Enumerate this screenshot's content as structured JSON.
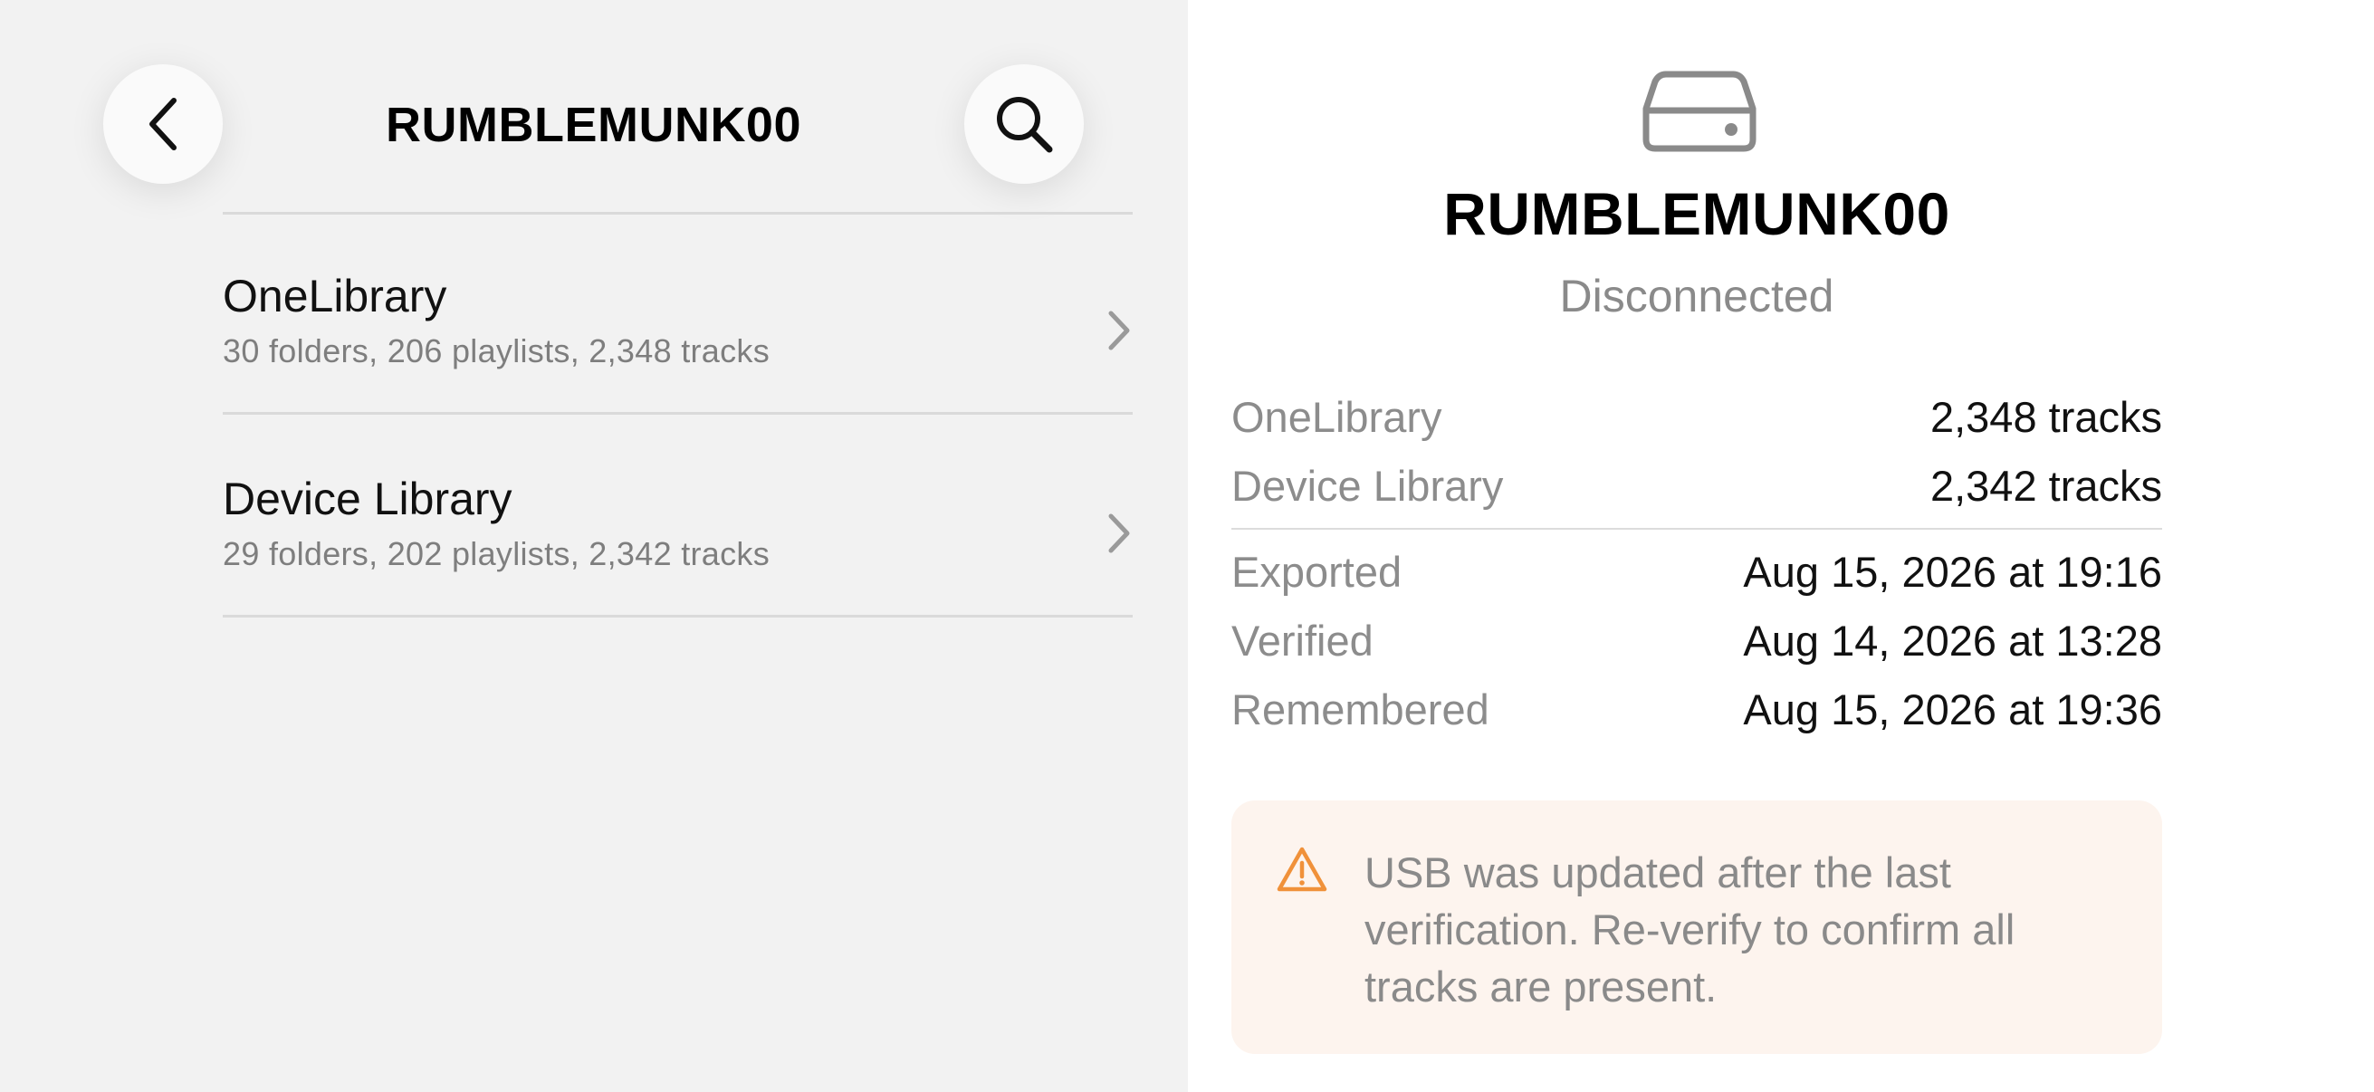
{
  "nav": {
    "title": "RUMBLEMUNK00",
    "back_icon": "chevron-left-icon",
    "search_icon": "search-icon"
  },
  "libraries": [
    {
      "title": "OneLibrary",
      "subtitle": "30 folders, 206 playlists, 2,348 tracks"
    },
    {
      "title": "Device Library",
      "subtitle": "29 folders, 202 playlists, 2,342 tracks"
    }
  ],
  "device": {
    "icon": "drive-icon",
    "name": "RUMBLEMUNK00",
    "status": "Disconnected"
  },
  "counts": [
    {
      "label": "OneLibrary",
      "value": "2,348 tracks"
    },
    {
      "label": "Device Library",
      "value": "2,342 tracks"
    }
  ],
  "dates": [
    {
      "label": "Exported",
      "value": "Aug 15, 2026 at 19:16"
    },
    {
      "label": "Verified",
      "value": "Aug 14, 2026 at 13:28"
    },
    {
      "label": "Remembered",
      "value": "Aug 15, 2026 at 19:36"
    }
  ],
  "warning": {
    "icon": "warning-icon",
    "text": "USB was updated after the last verification. Re-verify to confirm all tracks are present.",
    "accent": "#f0913a",
    "background": "#fdf4ee"
  }
}
